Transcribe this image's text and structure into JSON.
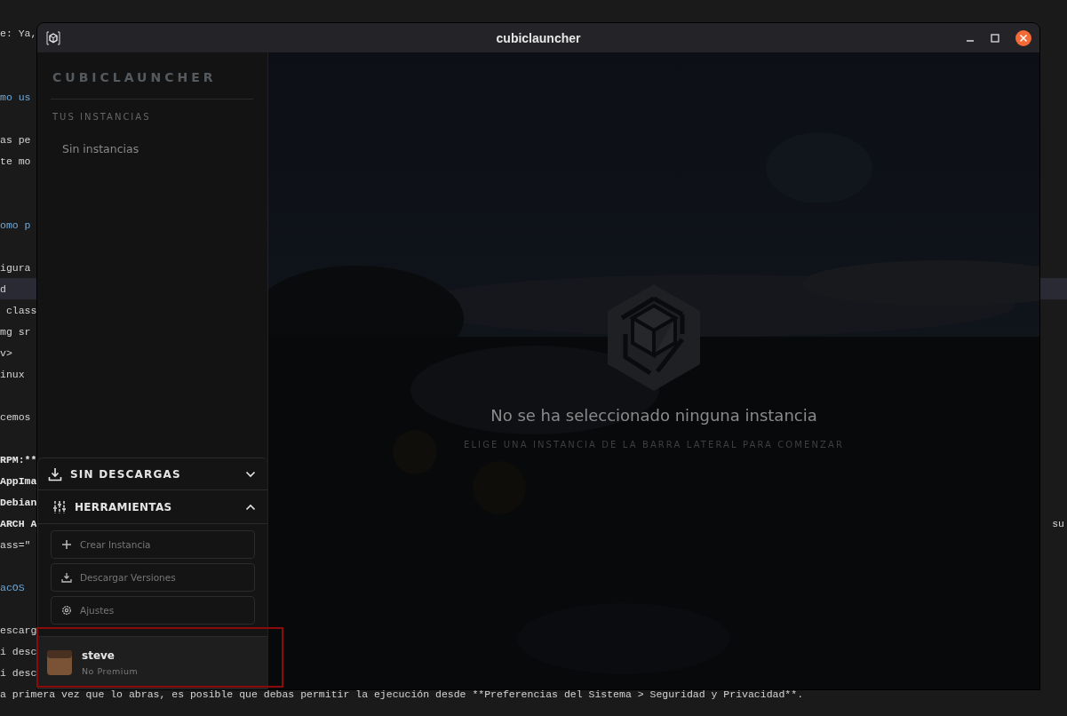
{
  "editor": {
    "lines": [
      {
        "kind": "text",
        "text": "e: Ya,",
        "current": false
      },
      {
        "kind": "blank",
        "current": false
      },
      {
        "kind": "blank",
        "current": false
      },
      {
        "kind": "heading",
        "text": "mo us",
        "current": false
      },
      {
        "kind": "blank",
        "current": false
      },
      {
        "kind": "text",
        "text": "as pe",
        "current": false
      },
      {
        "kind": "text",
        "text": "te mo",
        "current": false
      },
      {
        "kind": "blank",
        "current": false
      },
      {
        "kind": "blank",
        "current": false
      },
      {
        "kind": "heading",
        "text": "omo p",
        "current": false
      },
      {
        "kind": "blank",
        "current": false
      },
      {
        "kind": "text",
        "text": "igura",
        "current": false
      },
      {
        "kind": "text",
        "text": "d",
        "current": true
      },
      {
        "kind": "text",
        "text": " class",
        "current": false
      },
      {
        "kind": "text",
        "text": "mg sr",
        "current": false
      },
      {
        "kind": "text",
        "text": "v>",
        "current": false
      },
      {
        "kind": "text",
        "text": "inux",
        "current": false
      },
      {
        "kind": "blank",
        "current": false
      },
      {
        "kind": "text",
        "text": "cemos",
        "current": false
      },
      {
        "kind": "blank",
        "current": false
      },
      {
        "kind": "bold",
        "text": "RPM:**",
        "current": false
      },
      {
        "kind": "bold",
        "text": "AppIma",
        "current": false
      },
      {
        "kind": "bold",
        "text": "Debian",
        "current": false
      },
      {
        "kind": "bold",
        "text": "ARCH A",
        "aside": "su",
        "current": false
      },
      {
        "kind": "text",
        "text": "ass=\"",
        "current": false
      },
      {
        "kind": "blank",
        "current": false
      },
      {
        "kind": "heading",
        "text": "acOS",
        "current": false
      },
      {
        "kind": "blank",
        "current": false
      },
      {
        "kind": "text",
        "text": "escarg",
        "current": false
      },
      {
        "kind": "text",
        "text": "i desc",
        "current": false
      },
      {
        "kind": "text",
        "text": "i desc",
        "current": false
      },
      {
        "kind": "text",
        "text": "a primera vez que lo abras, es posible que debas permitir la ejecución desde **Preferencias del Sistema > Seguridad y Privacidad**.",
        "current": false
      }
    ]
  },
  "window": {
    "title": "cubiclauncher"
  },
  "sidebar": {
    "brand": "CUBICLAUNCHER",
    "section_title": "TUS INSTANCIAS",
    "empty_text": "Sin instancias",
    "panels": [
      {
        "kind": "downloads",
        "label": "SIN DESCARGAS",
        "expanded": false
      },
      {
        "kind": "tools",
        "label": "HERRAMIENTAS",
        "expanded": true,
        "buttons": [
          {
            "kind": "create",
            "label": "Crear Instancia"
          },
          {
            "kind": "download",
            "label": "Descargar Versiones"
          },
          {
            "kind": "settings",
            "label": "Ajustes"
          }
        ]
      }
    ],
    "account": {
      "name": "steve",
      "status": "No Premium"
    }
  },
  "main": {
    "heading": "No se ha seleccionado ninguna instancia",
    "subtitle": "ELIGE UNA INSTANCIA DE LA BARRA LATERAL PARA COMENZAR"
  }
}
